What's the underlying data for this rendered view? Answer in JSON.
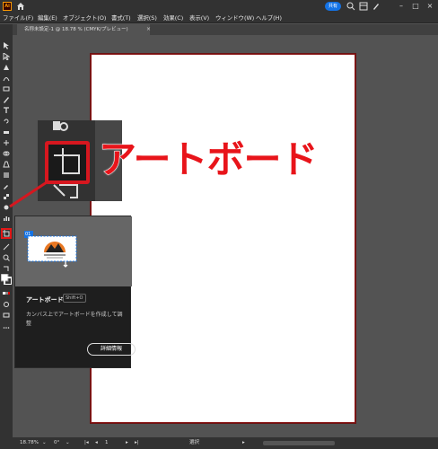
{
  "app": {
    "logo": "Ai",
    "share_label": "共有"
  },
  "menu": [
    "ファイル(F)",
    "編集(E)",
    "オブジェクト(O)",
    "書式(T)",
    "選択(S)",
    "効果(C)",
    "表示(V)",
    "ウィンドウ(W)",
    "ヘルプ(H)"
  ],
  "document_tab": {
    "title": "名称未設定-1 @ 18.78 % (CMYK/プレビュー)",
    "close": "×"
  },
  "callout": {
    "label": "アートボード"
  },
  "tooltip": {
    "badge": "01",
    "title": "アートボード",
    "shortcut": "Shift+O",
    "description": "カンバス上でアートボードを作成して調整",
    "button": "詳細情報"
  },
  "statusbar": {
    "zoom": "18.78%",
    "rotation": "0°",
    "page": "1",
    "mode": "選択"
  },
  "colors": {
    "accent": "#d6171f",
    "share": "#1473e6"
  },
  "icons": [
    "home-icon",
    "search-icon",
    "cloud-icon",
    "layout-icon",
    "brush-icon"
  ]
}
